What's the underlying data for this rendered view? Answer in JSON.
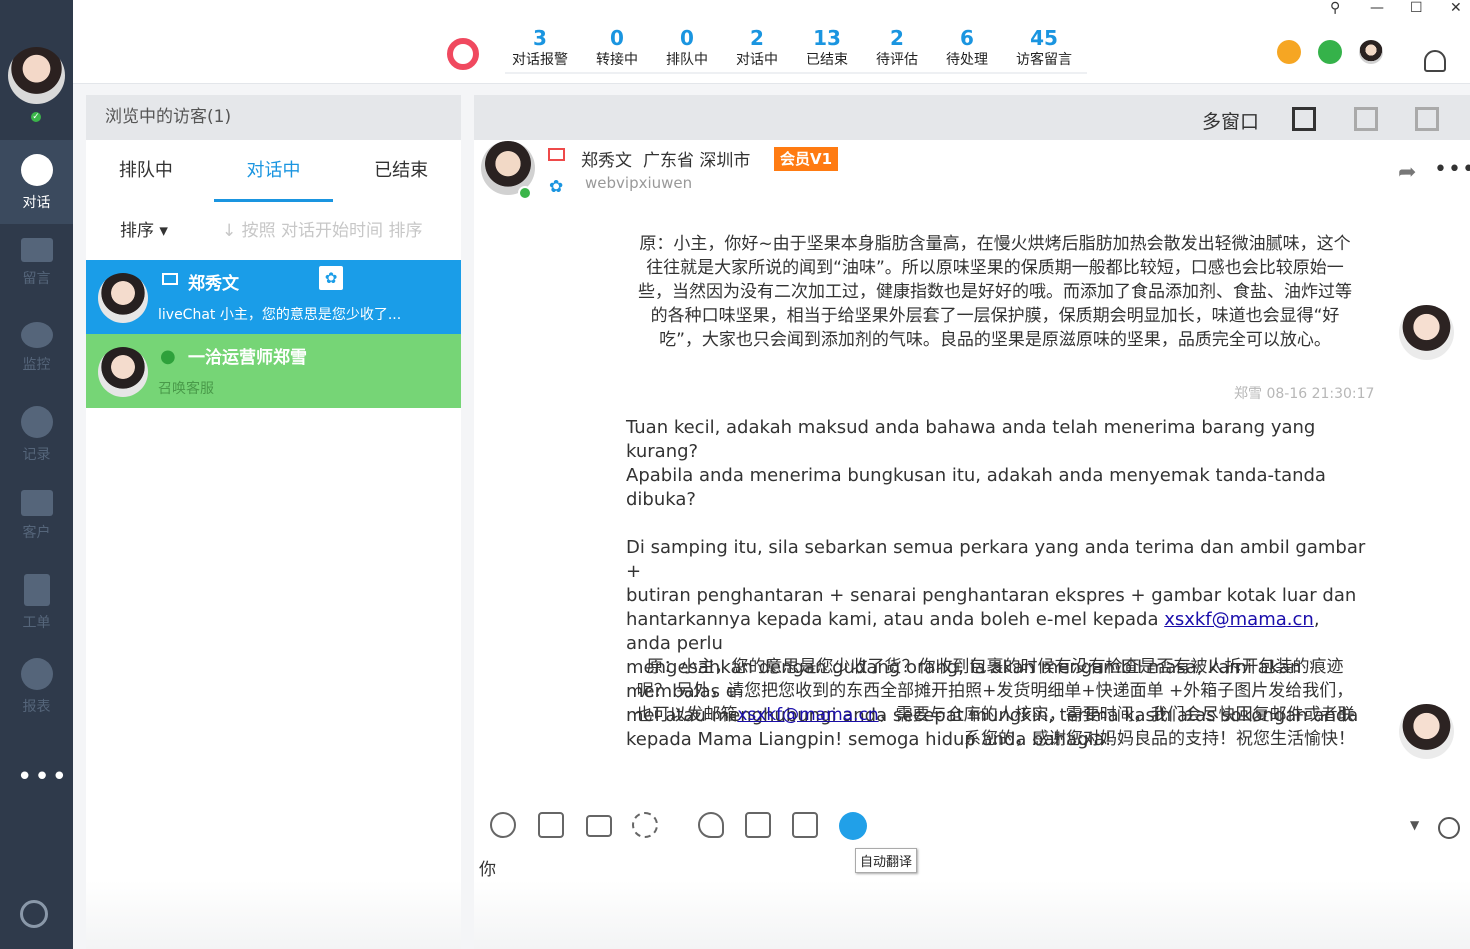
{
  "nav": {
    "items": [
      {
        "label": "对话",
        "icon": "chat-bubble-icon"
      },
      {
        "label": "留言",
        "icon": "envelope-icon"
      },
      {
        "label": "监控",
        "icon": "eye-icon"
      },
      {
        "label": "记录",
        "icon": "clock-icon"
      },
      {
        "label": "客户",
        "icon": "contact-card-icon"
      },
      {
        "label": "工单",
        "icon": "clipboard-icon"
      },
      {
        "label": "报表",
        "icon": "pie-chart-icon"
      }
    ],
    "more": "•••",
    "online_mark": "✓"
  },
  "stats": [
    {
      "num": "3",
      "label": "对话报警"
    },
    {
      "num": "0",
      "label": "转接中"
    },
    {
      "num": "0",
      "label": "排队中"
    },
    {
      "num": "2",
      "label": "对话中"
    },
    {
      "num": "13",
      "label": "已结束"
    },
    {
      "num": "2",
      "label": "待评估"
    },
    {
      "num": "6",
      "label": "待处理"
    },
    {
      "num": "45",
      "label": "访客留言"
    }
  ],
  "window_controls": {
    "pin": "⚲",
    "minimize": "—",
    "maximize": "☐",
    "close": "✕"
  },
  "visitors": {
    "header": "浏览中的访客(1)",
    "tabs": [
      "排队中",
      "对话中",
      "已结束"
    ],
    "sort_label": "排序 ▾",
    "sort_hint": "↓ 按照  对话开始时间 排序",
    "rows": [
      {
        "name": "郑秀文",
        "message": "liveChat 小主，您的意思是您少收了...",
        "source_icon": "baidu-paw-icon"
      },
      {
        "name": "一洽运营师郑雪",
        "message": "召唤客服",
        "source_icon": "wechat-icon"
      }
    ]
  },
  "chat": {
    "toolbar_label": "多窗口",
    "customer": {
      "name": "郑秀文",
      "location": "广东省 深圳市",
      "badge": "会员V1",
      "site": "webvipxiuwen"
    },
    "messages": {
      "cn1_lines": [
        "原：小主，你好~由于坚果本身脂肪含量高，在慢火烘烤后脂肪加热会散发出轻微油腻味，这个",
        "往往就是大家所说的闻到“油味”。所以原味坚果的保质期一般都比较短，口感也会比较原始一",
        "些，当然因为没有二次加工过，健康指数也是好好的哦。而添加了食品添加剂、食盐、油炸过等",
        "的各种口味坚果，相当于给坚果外层套了一层保护膜，保质期会明显加长，味道也会显得“好",
        "吃”，大家也只会闻到添加剂的气味。良品的坚果是原滋原味的坚果，品质完全可以放心。"
      ],
      "timestamp": "郑雪  08-16 21:30:17",
      "en_p1": [
        "Tuan kecil, adakah maksud anda bahawa anda telah menerima barang yang kurang?",
        "Apabila anda menerima bungkusan itu, adakah anda menyemak tanda-tanda dibuka?"
      ],
      "en_p2_a": [
        "Di samping itu, sila sebarkan semua perkara yang anda terima dan ambil gambar +",
        "butiran penghantaran + senarai penghantaran ekspres + gambar kotak luar dan"
      ],
      "en_p2_b_before": "hantarkannya kepada kami, atau anda boleh e-mel kepada ",
      "email": "xsxkf@mama.cn",
      "en_p2_b_after": ", anda perlu",
      "en_p2_c": [
        "mengesahkan dengan gudang orang, ia akan mengambil masa, kami akan membalas e-",
        "mel atau menghubungi anda secepat mungkin, terima kasih atas sokongan anda",
        "kepada Mama Liangpin! semoga hidup anda bahagia!"
      ],
      "cn2_l1": "原：小主，您的意思是您少收了货？你收到包裹的时候有没有检查是否有被人拆开包装的痕迹",
      "cn2_l2": "呢？ 另外，请您把您收到的东西全部摊开拍照+发货明细单+快递面单 +外箱子图片发给我们，",
      "cn2_l3_before": "也可以发邮箱",
      "cn2_l3_after": "，需要与仓库的人核实，需要时间，我们会尽快回复邮件或者联",
      "cn2_l4": "系您的，感谢您对妈妈良品的支持！祝您生活愉快！"
    },
    "input_value": "你",
    "tooltip": "自动翻译"
  }
}
